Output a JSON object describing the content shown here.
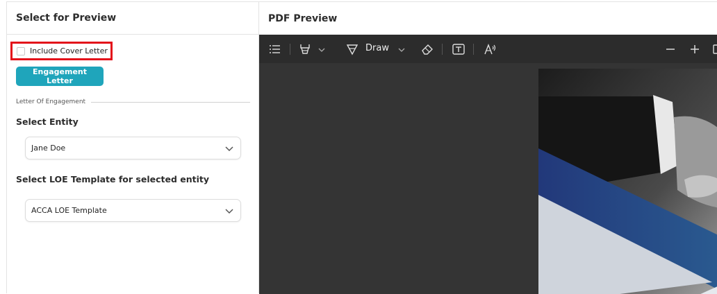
{
  "left_panel": {
    "title": "Select for Preview",
    "cover_letter": {
      "label": "Include Cover Letter",
      "checked": false
    },
    "engagement_button": "Engagement Letter",
    "section_label": "Letter Of Engagement",
    "entity": {
      "label": "Select Entity",
      "value": "Jane Doe"
    },
    "template": {
      "label": "Select LOE Template for selected entity",
      "value": "ACCA LOE Template"
    }
  },
  "right_panel": {
    "title": "PDF Preview",
    "toolbar": {
      "icons": [
        "list-icon",
        "highlighter-icon",
        "chevron-down-icon",
        "pen-icon",
        "chevron-down-icon",
        "eraser-icon",
        "text-box-icon",
        "text-to-speech-icon",
        "zoom-out-icon",
        "zoom-in-icon"
      ],
      "draw_label": "Draw"
    }
  },
  "colors": {
    "accent": "#1fa5bb",
    "highlight_border": "#e3101a",
    "toolbar_bg": "#2c2c2c",
    "viewer_bg": "#343434"
  }
}
